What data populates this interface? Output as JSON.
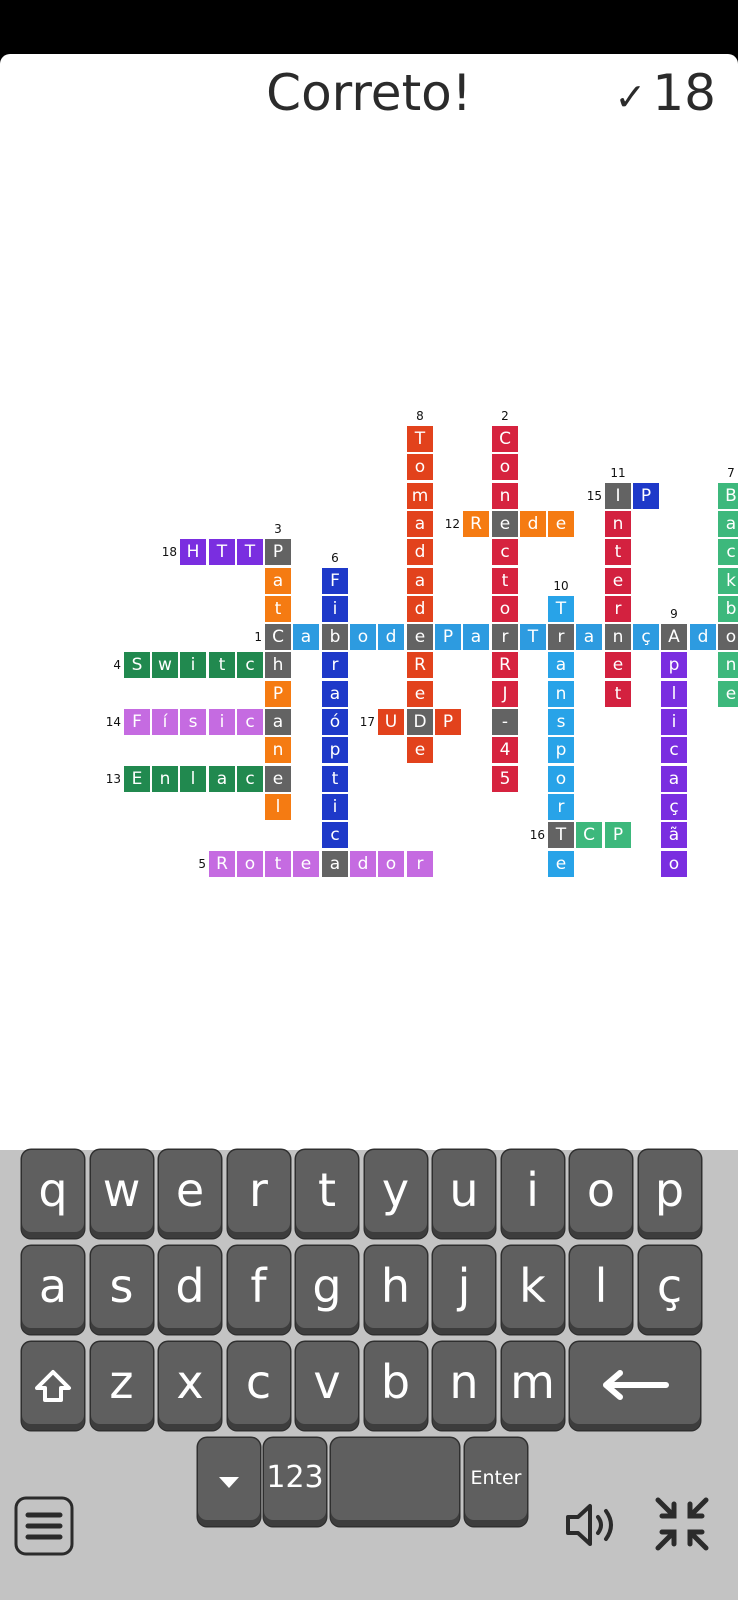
{
  "header": {
    "title": "Correto!",
    "check_icon": "✓",
    "score": "18"
  },
  "crossword": {
    "palette": {
      "gray": "#636363",
      "sky": "#2d9be0",
      "red": "#d6233f",
      "orange": "#f57b12",
      "vermilion": "#e2421c",
      "navy": "#1e39c9",
      "crimson": "#d3213f",
      "teal": "#3db87c",
      "purple": "#7a2ee0",
      "green": "#21894f",
      "pink": "#c56be1",
      "blue": "#28a3e8"
    },
    "rows": [
      {
        "y": 0,
        "cells": [
          {
            "x": 12,
            "l": "T",
            "c": "vermilion"
          },
          {
            "x": 15,
            "l": "C",
            "c": "red"
          }
        ]
      },
      {
        "y": 1,
        "cells": [
          {
            "x": 12,
            "l": "o",
            "c": "vermilion"
          },
          {
            "x": 15,
            "l": "o",
            "c": "red"
          }
        ]
      },
      {
        "y": 2,
        "cells": [
          {
            "x": 12,
            "l": "m",
            "c": "vermilion"
          },
          {
            "x": 15,
            "l": "n",
            "c": "red"
          },
          {
            "x": 19,
            "l": "I",
            "c": "gray"
          },
          {
            "x": 20,
            "l": "P",
            "c": "navy"
          },
          {
            "x": 23,
            "l": "B",
            "c": "teal"
          }
        ]
      },
      {
        "y": 3,
        "cells": [
          {
            "x": 12,
            "l": "a",
            "c": "vermilion"
          },
          {
            "x": 14,
            "l": "R",
            "c": "orange"
          },
          {
            "x": 15,
            "l": "e",
            "c": "gray"
          },
          {
            "x": 16,
            "l": "d",
            "c": "orange"
          },
          {
            "x": 17,
            "l": "e",
            "c": "orange"
          },
          {
            "x": 19,
            "l": "n",
            "c": "crimson"
          },
          {
            "x": 23,
            "l": "a",
            "c": "teal"
          }
        ]
      },
      {
        "y": 4,
        "cells": [
          {
            "x": 4,
            "l": "H",
            "c": "purple"
          },
          {
            "x": 5,
            "l": "T",
            "c": "purple"
          },
          {
            "x": 6,
            "l": "T",
            "c": "purple"
          },
          {
            "x": 7,
            "l": "P",
            "c": "gray"
          },
          {
            "x": 12,
            "l": "d",
            "c": "vermilion"
          },
          {
            "x": 15,
            "l": "c",
            "c": "red"
          },
          {
            "x": 19,
            "l": "t",
            "c": "crimson"
          },
          {
            "x": 23,
            "l": "c",
            "c": "teal"
          }
        ]
      },
      {
        "y": 5,
        "cells": [
          {
            "x": 7,
            "l": "a",
            "c": "orange"
          },
          {
            "x": 9,
            "l": "F",
            "c": "navy"
          },
          {
            "x": 12,
            "l": "a",
            "c": "vermilion"
          },
          {
            "x": 15,
            "l": "t",
            "c": "red"
          },
          {
            "x": 19,
            "l": "e",
            "c": "crimson"
          },
          {
            "x": 23,
            "l": "k",
            "c": "teal"
          }
        ]
      },
      {
        "y": 6,
        "cells": [
          {
            "x": 7,
            "l": "t",
            "c": "orange"
          },
          {
            "x": 9,
            "l": "i",
            "c": "navy"
          },
          {
            "x": 12,
            "l": "d",
            "c": "vermilion"
          },
          {
            "x": 15,
            "l": "o",
            "c": "red"
          },
          {
            "x": 17,
            "l": "T",
            "c": "blue"
          },
          {
            "x": 19,
            "l": "r",
            "c": "crimson"
          },
          {
            "x": 23,
            "l": "b",
            "c": "teal"
          }
        ]
      },
      {
        "y": 7,
        "cells": [
          {
            "x": 7,
            "l": "C",
            "c": "gray"
          },
          {
            "x": 8,
            "l": "a",
            "c": "sky"
          },
          {
            "x": 9,
            "l": "b",
            "c": "gray"
          },
          {
            "x": 10,
            "l": "o",
            "c": "sky"
          },
          {
            "x": 11,
            "l": "d",
            "c": "sky"
          },
          {
            "x": 12,
            "l": "e",
            "c": "gray"
          },
          {
            "x": 13,
            "l": "P",
            "c": "sky"
          },
          {
            "x": 14,
            "l": "a",
            "c": "sky"
          },
          {
            "x": 15,
            "l": "r",
            "c": "gray"
          },
          {
            "x": 16,
            "l": "T",
            "c": "sky"
          },
          {
            "x": 17,
            "l": "r",
            "c": "gray"
          },
          {
            "x": 18,
            "l": "a",
            "c": "sky"
          },
          {
            "x": 19,
            "l": "n",
            "c": "gray"
          },
          {
            "x": 20,
            "l": "ç",
            "c": "sky"
          },
          {
            "x": 21,
            "l": "A",
            "c": "gray"
          },
          {
            "x": 22,
            "l": "d",
            "c": "sky"
          },
          {
            "x": 23,
            "l": "o",
            "c": "gray"
          }
        ]
      },
      {
        "y": 8,
        "cells": [
          {
            "x": 2,
            "l": "S",
            "c": "green"
          },
          {
            "x": 3,
            "l": "w",
            "c": "green"
          },
          {
            "x": 4,
            "l": "i",
            "c": "green"
          },
          {
            "x": 5,
            "l": "t",
            "c": "green"
          },
          {
            "x": 6,
            "l": "c",
            "c": "green"
          },
          {
            "x": 7,
            "l": "h",
            "c": "gray"
          },
          {
            "x": 9,
            "l": "r",
            "c": "navy"
          },
          {
            "x": 12,
            "l": "R",
            "c": "vermilion"
          },
          {
            "x": 15,
            "l": "R",
            "c": "red"
          },
          {
            "x": 17,
            "l": "a",
            "c": "blue"
          },
          {
            "x": 19,
            "l": "e",
            "c": "crimson"
          },
          {
            "x": 21,
            "l": "p",
            "c": "purple"
          },
          {
            "x": 23,
            "l": "n",
            "c": "teal"
          }
        ]
      },
      {
        "y": 9,
        "cells": [
          {
            "x": 7,
            "l": "P",
            "c": "orange"
          },
          {
            "x": 9,
            "l": "a",
            "c": "navy"
          },
          {
            "x": 12,
            "l": "e",
            "c": "vermilion"
          },
          {
            "x": 15,
            "l": "J",
            "c": "red"
          },
          {
            "x": 17,
            "l": "n",
            "c": "blue"
          },
          {
            "x": 19,
            "l": "t",
            "c": "crimson"
          },
          {
            "x": 21,
            "l": "l",
            "c": "purple"
          },
          {
            "x": 23,
            "l": "e",
            "c": "teal"
          }
        ]
      },
      {
        "y": 10,
        "cells": [
          {
            "x": 2,
            "l": "F",
            "c": "pink"
          },
          {
            "x": 3,
            "l": "í",
            "c": "pink"
          },
          {
            "x": 4,
            "l": "s",
            "c": "pink"
          },
          {
            "x": 5,
            "l": "i",
            "c": "pink"
          },
          {
            "x": 6,
            "l": "c",
            "c": "pink"
          },
          {
            "x": 7,
            "l": "a",
            "c": "gray"
          },
          {
            "x": 9,
            "l": "ó",
            "c": "navy"
          },
          {
            "x": 11,
            "l": "U",
            "c": "vermilion"
          },
          {
            "x": 12,
            "l": "D",
            "c": "gray"
          },
          {
            "x": 13,
            "l": "P",
            "c": "vermilion"
          },
          {
            "x": 15,
            "l": "-",
            "c": "gray"
          },
          {
            "x": 17,
            "l": "s",
            "c": "blue"
          },
          {
            "x": 21,
            "l": "i",
            "c": "purple"
          }
        ]
      },
      {
        "y": 11,
        "cells": [
          {
            "x": 7,
            "l": "n",
            "c": "orange"
          },
          {
            "x": 9,
            "l": "p",
            "c": "navy"
          },
          {
            "x": 12,
            "l": "e",
            "c": "vermilion"
          },
          {
            "x": 15,
            "l": "4",
            "c": "red"
          },
          {
            "x": 17,
            "l": "p",
            "c": "blue"
          },
          {
            "x": 21,
            "l": "c",
            "c": "purple"
          }
        ]
      },
      {
        "y": 12,
        "cells": [
          {
            "x": 2,
            "l": "E",
            "c": "green"
          },
          {
            "x": 3,
            "l": "n",
            "c": "green"
          },
          {
            "x": 4,
            "l": "l",
            "c": "green"
          },
          {
            "x": 5,
            "l": "a",
            "c": "green"
          },
          {
            "x": 6,
            "l": "c",
            "c": "green"
          },
          {
            "x": 7,
            "l": "e",
            "c": "gray"
          },
          {
            "x": 9,
            "l": "t",
            "c": "navy"
          },
          {
            "x": 15,
            "l": "5",
            "c": "red"
          },
          {
            "x": 17,
            "l": "o",
            "c": "blue"
          },
          {
            "x": 21,
            "l": "a",
            "c": "purple"
          }
        ]
      },
      {
        "y": 13,
        "cells": [
          {
            "x": 7,
            "l": "l",
            "c": "orange"
          },
          {
            "x": 9,
            "l": "i",
            "c": "navy"
          },
          {
            "x": 17,
            "l": "r",
            "c": "blue"
          },
          {
            "x": 21,
            "l": "ç",
            "c": "purple"
          }
        ]
      },
      {
        "y": 14,
        "cells": [
          {
            "x": 9,
            "l": "c",
            "c": "navy"
          },
          {
            "x": 17,
            "l": "T",
            "c": "gray"
          },
          {
            "x": 18,
            "l": "C",
            "c": "teal"
          },
          {
            "x": 19,
            "l": "P",
            "c": "teal"
          },
          {
            "x": 21,
            "l": "ã",
            "c": "purple"
          }
        ]
      },
      {
        "y": 15,
        "cells": [
          {
            "x": 5,
            "l": "R",
            "c": "pink"
          },
          {
            "x": 6,
            "l": "o",
            "c": "pink"
          },
          {
            "x": 7,
            "l": "t",
            "c": "pink"
          },
          {
            "x": 8,
            "l": "e",
            "c": "pink"
          },
          {
            "x": 9,
            "l": "a",
            "c": "gray"
          },
          {
            "x": 10,
            "l": "d",
            "c": "pink"
          },
          {
            "x": 11,
            "l": "o",
            "c": "pink"
          },
          {
            "x": 12,
            "l": "r",
            "c": "pink"
          },
          {
            "x": 17,
            "l": "e",
            "c": "blue"
          },
          {
            "x": 21,
            "l": "o",
            "c": "purple"
          }
        ]
      }
    ],
    "clues": [
      {
        "n": "8",
        "x": 12,
        "y": 0,
        "pos": "above"
      },
      {
        "n": "2",
        "x": 15,
        "y": 0,
        "pos": "above"
      },
      {
        "n": "11",
        "x": 19,
        "y": 2,
        "pos": "above"
      },
      {
        "n": "7",
        "x": 23,
        "y": 2,
        "pos": "above"
      },
      {
        "n": "15",
        "x": 19,
        "y": 2,
        "pos": "left"
      },
      {
        "n": "12",
        "x": 14,
        "y": 3,
        "pos": "left"
      },
      {
        "n": "3",
        "x": 7,
        "y": 4,
        "pos": "above"
      },
      {
        "n": "18",
        "x": 4,
        "y": 4,
        "pos": "left"
      },
      {
        "n": "6",
        "x": 9,
        "y": 5,
        "pos": "above"
      },
      {
        "n": "10",
        "x": 17,
        "y": 6,
        "pos": "above"
      },
      {
        "n": "9",
        "x": 21,
        "y": 7,
        "pos": "above"
      },
      {
        "n": "1",
        "x": 7,
        "y": 7,
        "pos": "left"
      },
      {
        "n": "4",
        "x": 2,
        "y": 8,
        "pos": "left"
      },
      {
        "n": "14",
        "x": 2,
        "y": 10,
        "pos": "left"
      },
      {
        "n": "17",
        "x": 11,
        "y": 10,
        "pos": "left"
      },
      {
        "n": "13",
        "x": 2,
        "y": 12,
        "pos": "left"
      },
      {
        "n": "16",
        "x": 17,
        "y": 14,
        "pos": "left"
      },
      {
        "n": "5",
        "x": 5,
        "y": 15,
        "pos": "left"
      }
    ]
  },
  "keyboard": {
    "row1": [
      "q",
      "w",
      "e",
      "r",
      "t",
      "y",
      "u",
      "i",
      "o",
      "p"
    ],
    "row2": [
      "a",
      "s",
      "d",
      "f",
      "g",
      "h",
      "j",
      "k",
      "l",
      "ç"
    ],
    "row3": [
      "z",
      "x",
      "c",
      "v",
      "b",
      "n",
      "m"
    ],
    "shift_icon": "shift-arrow-icon",
    "backspace_icon": "backspace-arrow-icon",
    "hide_icon": "triangle-down-icon",
    "numbers_label": "123",
    "space_label": "",
    "enter_label": "Enter"
  },
  "bottom_bar": {
    "menu_icon": "hamburger-menu-icon",
    "sound_icon": "speaker-icon",
    "collapse_icon": "collapse-arrows-icon"
  }
}
